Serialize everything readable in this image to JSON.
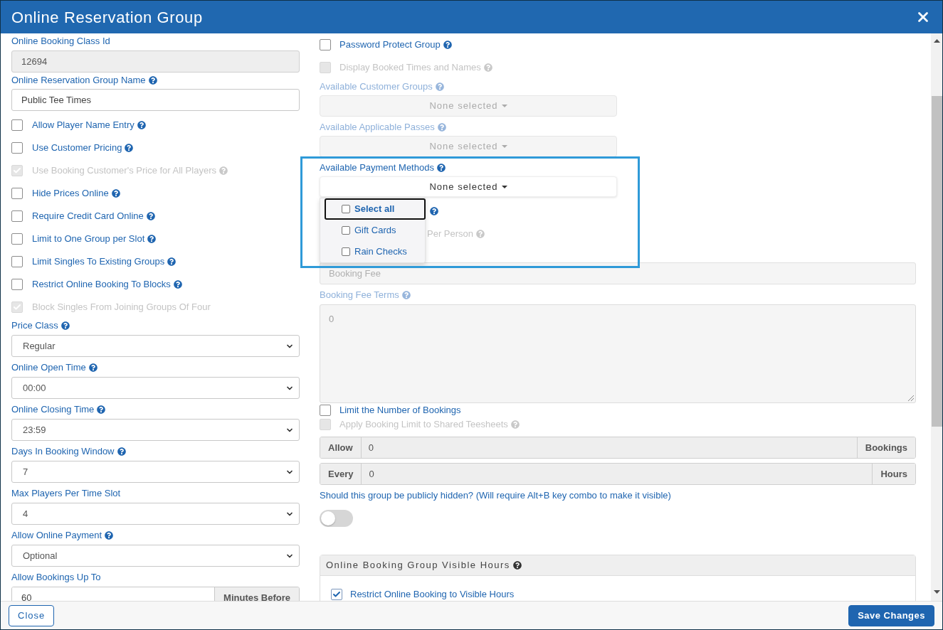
{
  "dialog": {
    "title": "Online Reservation Group"
  },
  "left_column": {
    "class_id": {
      "label": "Online Booking Class Id",
      "value": "12694",
      "disabled": true
    },
    "group_name": {
      "label": "Online Reservation Group Name",
      "help": true,
      "value": "Public Tee Times",
      "disabled": false
    },
    "options": [
      {
        "label": "Allow Player Name Entry",
        "checked": false,
        "disabled": false,
        "help": true
      },
      {
        "label": "Use Customer Pricing",
        "checked": false,
        "disabled": false,
        "help": true
      },
      {
        "label": "Use Booking Customer's Price for All Players",
        "checked": true,
        "disabled": true,
        "help": true
      },
      {
        "label": "Hide Prices Online",
        "checked": false,
        "disabled": false,
        "help": true
      },
      {
        "label": "Require Credit Card Online",
        "checked": false,
        "disabled": false,
        "help": true
      },
      {
        "label": "Limit to One Group per Slot",
        "checked": false,
        "disabled": false,
        "help": true
      },
      {
        "label": "Limit Singles To Existing Groups",
        "checked": false,
        "disabled": false,
        "help": true
      },
      {
        "label": "Restrict Online Booking To Blocks",
        "checked": false,
        "disabled": false,
        "help": true
      },
      {
        "label": "Block Singles From Joining Groups Of Four",
        "checked": true,
        "disabled": true,
        "help": false
      }
    ],
    "selects": [
      {
        "label": "Price Class",
        "help": true,
        "value": "Regular"
      },
      {
        "label": "Online Open Time",
        "help": true,
        "value": "00:00"
      },
      {
        "label": "Online Closing Time",
        "help": true,
        "value": "23:59"
      },
      {
        "label": "Days In Booking Window",
        "help": true,
        "value": "7"
      },
      {
        "label": "Max Players Per Time Slot",
        "help": false,
        "value": "4"
      },
      {
        "label": "Allow Online Payment",
        "help": true,
        "value": "Optional"
      }
    ],
    "bookings_up_to": {
      "label": "Allow Bookings Up To",
      "value": "60",
      "suffix": "Minutes Before"
    }
  },
  "right_column": {
    "options": [
      {
        "label": "Password Protect Group",
        "checked": false,
        "disabled": false,
        "help": true
      },
      {
        "label": "Display Booked Times and Names",
        "checked": false,
        "disabled": true,
        "help": true
      }
    ],
    "multiselects": [
      {
        "label": "Available Customer Groups",
        "help": true,
        "disabled": true,
        "button_text": "None selected",
        "expanded": false,
        "highlighted": false
      },
      {
        "label": "Available Applicable Passes",
        "help": true,
        "disabled": true,
        "button_text": "None selected",
        "expanded": false,
        "highlighted": false
      },
      {
        "label": "Available Payment Methods",
        "help": true,
        "disabled": false,
        "button_text": "None selected",
        "expanded": true,
        "highlighted": true,
        "menu": [
          {
            "label": "Select all",
            "kind": "select_all",
            "checked": false,
            "focused": true
          },
          {
            "label": "Gift Cards",
            "kind": "option",
            "checked": false,
            "focused": false
          },
          {
            "label": "Rain Checks",
            "kind": "option",
            "checked": false,
            "focused": false
          }
        ]
      }
    ],
    "covered_rows": [
      {
        "help": true,
        "disabled": false
      },
      {
        "label": "Per Person",
        "help": true,
        "disabled": true
      }
    ],
    "booking_fee": {
      "placeholder": "Booking Fee",
      "disabled": true
    },
    "booking_fee_terms": {
      "label": "Booking Fee Terms",
      "help": true,
      "placeholder": "0",
      "disabled": true
    },
    "limit_options": [
      {
        "label": "Limit the Number of Bookings",
        "checked": false,
        "disabled": false,
        "help": false
      },
      {
        "label": "Apply Booking Limit to Shared Teesheets",
        "checked": false,
        "disabled": true,
        "help": true
      }
    ],
    "limit_groups": [
      {
        "prefix": "Allow",
        "value": "0",
        "suffix": "Bookings",
        "disabled": true
      },
      {
        "prefix": "Every",
        "value": "0",
        "suffix": "Hours",
        "disabled": true
      }
    ],
    "hidden_question": {
      "label": "Should this group be publicly hidden? (Will require Alt+B key combo to make it visible)",
      "on": false
    },
    "visible_hours_panel": {
      "title": "Online Booking Group Visible Hours",
      "help": true,
      "options": [
        {
          "label": "Restrict Online Booking to Visible Hours",
          "checked": true,
          "disabled": false,
          "help": false
        }
      ]
    }
  },
  "footer": {
    "buttons": [
      {
        "label": "Close",
        "kind": "secondary"
      },
      {
        "label": "Save Changes",
        "kind": "primary"
      }
    ]
  }
}
